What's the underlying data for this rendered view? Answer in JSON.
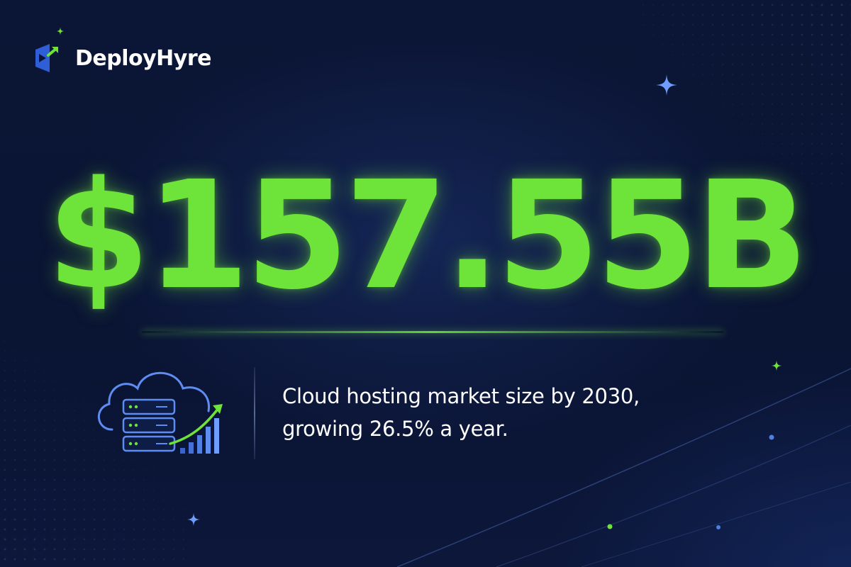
{
  "brand": {
    "name": "DeployHyre",
    "logo_icon": "deployhyre-logo-icon"
  },
  "stat": {
    "value": "$157.55B"
  },
  "caption": {
    "line1": "Cloud hosting market size by 2030,",
    "line2": "growing 26.5% a year."
  },
  "icons": {
    "illustration": "cloud-server-growth-icon",
    "sparkle": "sparkle-icon"
  },
  "colors": {
    "background": "#0b1535",
    "accent_green": "#6ee33a",
    "accent_blue": "#4f7fe0",
    "text": "#ffffff"
  }
}
